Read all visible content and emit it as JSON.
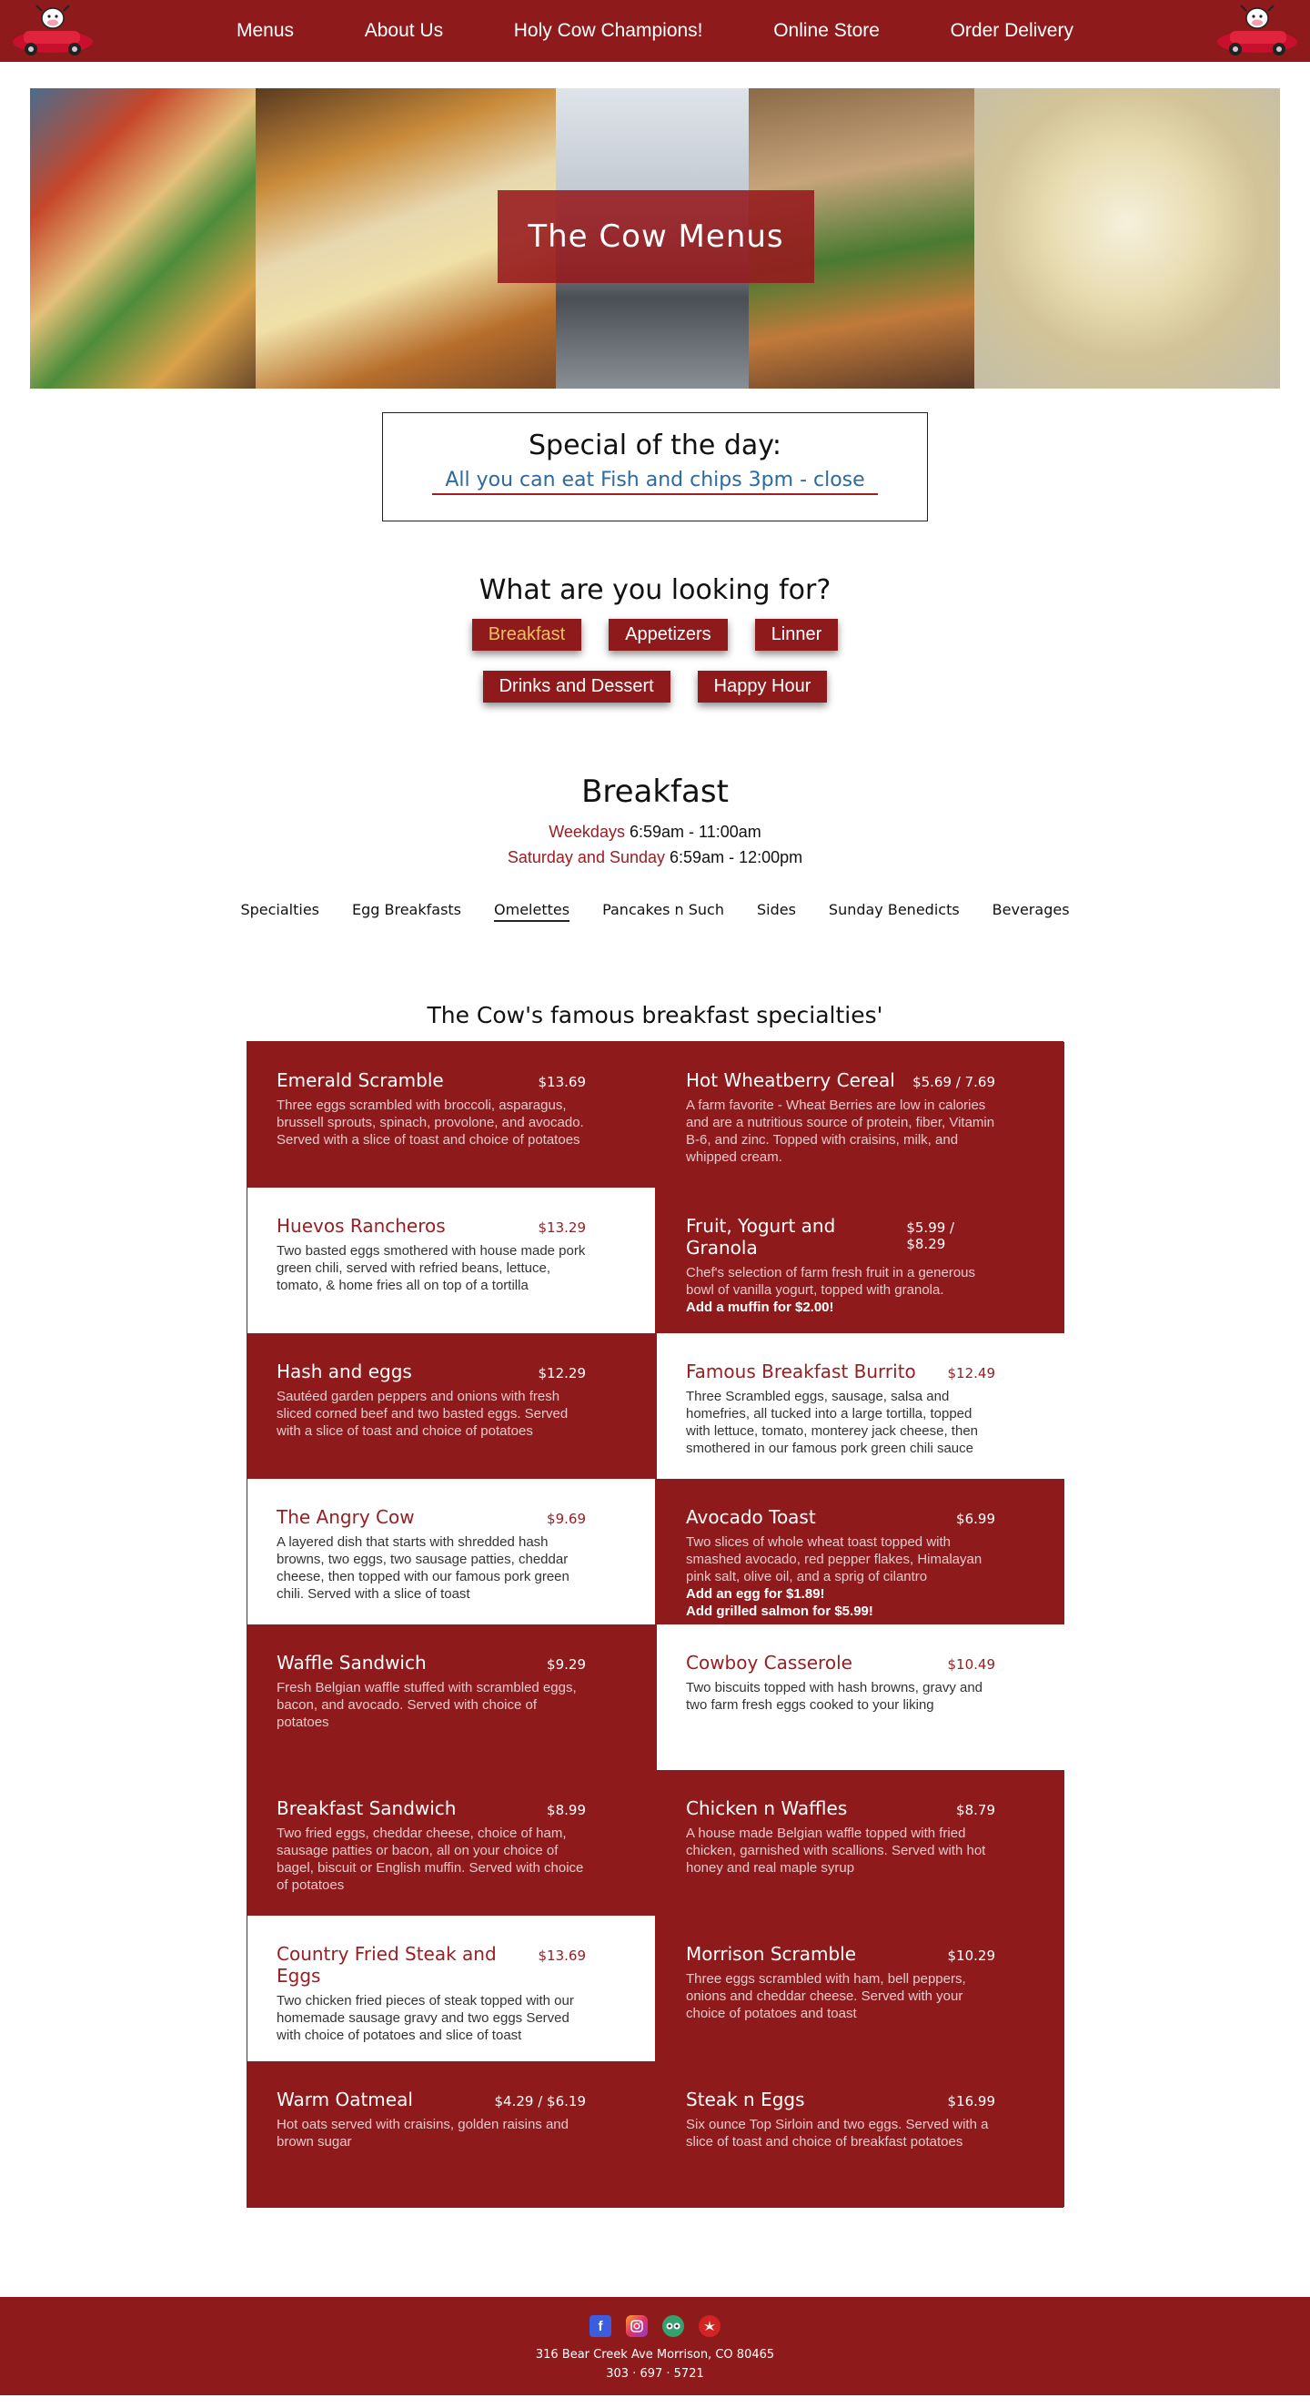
{
  "nav": {
    "items": [
      "Menus",
      "About Us",
      "Holy Cow Champions!",
      "Online Store",
      "Order Delivery"
    ]
  },
  "hero": {
    "title": "The Cow Menus"
  },
  "special": {
    "title": "Special of the day:",
    "link": "All you can eat Fish and chips 3pm - close"
  },
  "looking": {
    "title": "What are you looking for?",
    "buttons_row1": [
      "Breakfast",
      "Appetizers",
      "Linner"
    ],
    "buttons_row2": [
      "Drinks and Dessert",
      "Happy Hour"
    ],
    "active": "Breakfast"
  },
  "breakfast": {
    "title": "Breakfast",
    "weekdays_label": "Weekdays",
    "weekdays_hours": "6:59am - 11:00am",
    "weekend_label": "Saturday and Sunday",
    "weekend_hours": "6:59am - 12:00pm",
    "subnav": [
      "Specialties",
      "Egg Breakfasts",
      "Omelettes",
      "Pancakes n Such",
      "Sides",
      "Sunday Benedicts",
      "Beverages"
    ],
    "subnav_active": "Omelettes",
    "heading": "The Cow's famous breakfast specialties'"
  },
  "menu_items": [
    {
      "name": "Emerald Scramble",
      "price": "$13.69",
      "desc": "Three eggs scrambled with broccoli, asparagus, brussell sprouts, spinach, provolone, and avocado. Served with a slice of toast and choice of potatoes",
      "extra": [],
      "light": false
    },
    {
      "name": "Hot Wheatberry Cereal",
      "price": "$5.69 / 7.69",
      "desc": "A farm favorite - Wheat Berries are low in calories and are a nutritious source of protein, fiber, Vitamin B-6, and zinc. Topped with craisins, milk, and whipped cream.",
      "extra": [],
      "light": false
    },
    {
      "name": "Huevos Rancheros",
      "price": "$13.29",
      "desc": "Two basted eggs smothered with house made pork green chili, served with refried beans, lettuce, tomato, & home fries all on top of a tortilla",
      "extra": [],
      "light": true
    },
    {
      "name": "Fruit, Yogurt and Granola",
      "price": "$5.99 / $8.29",
      "desc": "Chef's selection of farm fresh fruit in a generous bowl of vanilla yogurt, topped with granola.",
      "extra": [
        "Add a muffin for $2.00!"
      ],
      "light": false
    },
    {
      "name": "Hash and eggs",
      "price": "$12.29",
      "desc": "Sautéed garden peppers and onions with fresh sliced corned beef and two basted eggs. Served with a slice of toast and choice of potatoes",
      "extra": [],
      "light": false
    },
    {
      "name": "Famous Breakfast Burrito",
      "price": "$12.49",
      "desc": "Three Scrambled eggs, sausage, salsa and homefries, all tucked into a large tortilla, topped with lettuce, tomato, monterey jack cheese, then smothered in our famous pork green chili sauce",
      "extra": [],
      "light": true
    },
    {
      "name": "The Angry Cow",
      "price": "$9.69",
      "desc": "A layered dish that starts with shredded hash browns, two eggs, two sausage patties, cheddar cheese, then topped with our famous pork green chili. Served with a slice of toast",
      "extra": [],
      "light": true
    },
    {
      "name": "Avocado Toast",
      "price": "$6.99",
      "desc": "Two slices of whole wheat toast topped with smashed avocado, red pepper flakes, Himalayan pink salt, olive oil, and a sprig of cilantro",
      "extra": [
        "Add an egg for $1.89!",
        "Add grilled salmon for $5.99!"
      ],
      "light": false
    },
    {
      "name": "Waffle Sandwich",
      "price": "$9.29",
      "desc": "Fresh Belgian waffle stuffed with scrambled eggs, bacon, and avocado. Served with choice of potatoes",
      "extra": [],
      "light": false
    },
    {
      "name": "Cowboy Casserole",
      "price": "$10.49",
      "desc": "Two biscuits topped with hash browns, gravy and two farm fresh eggs cooked to your liking",
      "extra": [],
      "light": true
    },
    {
      "name": "Breakfast Sandwich",
      "price": "$8.99",
      "desc": "Two fried eggs, cheddar cheese, choice of ham, sausage patties or bacon, all on your choice of bagel, biscuit or English muffin. Served with choice of potatoes",
      "extra": [],
      "light": false
    },
    {
      "name": "Chicken n Waffles",
      "price": "$8.79",
      "desc": "A house made Belgian waffle topped with fried chicken, garnished with scallions. Served with hot honey and real maple syrup",
      "extra": [],
      "light": false
    },
    {
      "name": "Country Fried Steak and Eggs",
      "price": "$13.69",
      "desc": "Two chicken fried pieces of steak topped with our homemade sausage gravy and two eggs Served with choice of potatoes and slice of toast",
      "extra": [],
      "light": true
    },
    {
      "name": "Morrison Scramble",
      "price": "$10.29",
      "desc": "Three eggs scrambled with ham, bell peppers, onions and cheddar cheese. Served with your choice of potatoes and toast",
      "extra": [],
      "light": false
    },
    {
      "name": "Warm Oatmeal",
      "price": "$4.29 / $6.19",
      "desc": "Hot oats served with craisins, golden raisins and brown sugar",
      "extra": [],
      "light": false
    },
    {
      "name": "Steak n Eggs",
      "price": "$16.99",
      "desc": "Six ounce Top Sirloin and two eggs. Served with a slice of toast and choice of breakfast potatoes",
      "extra": [],
      "light": false
    }
  ],
  "footer": {
    "social_icons": [
      "facebook-icon",
      "instagram-icon",
      "tripadvisor-icon",
      "yelp-icon"
    ],
    "address": "316 Bear Creek Ave Morrison, CO 80465",
    "phone": "303 · 697 · 5721"
  },
  "colors": {
    "brand_red": "#8e1a1c",
    "link_blue": "#2c6aa0",
    "active_button_text": "#f0c060"
  }
}
